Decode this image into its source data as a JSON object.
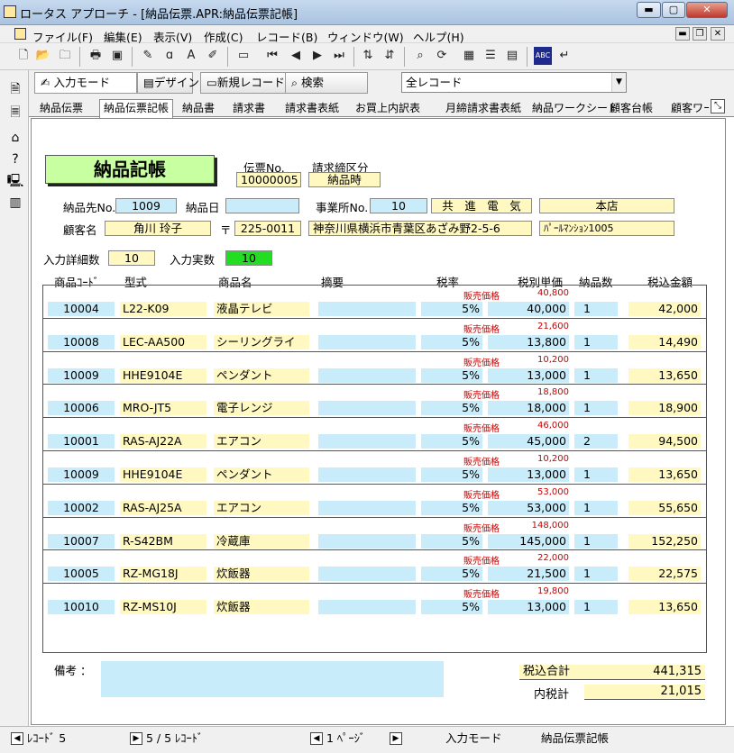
{
  "window": {
    "title": "ロータス アプローチ - [納品伝票.APR:納品伝票記帳]",
    "min_label": "▬",
    "max_label": "▢",
    "close_label": "✕"
  },
  "menu": [
    "ファイル(F)",
    "編集(E)",
    "表示(V)",
    "作成(C)",
    "レコード(B)",
    "ウィンドウ(W)",
    "ヘルプ(H)"
  ],
  "mode": {
    "input_label": "入力モード",
    "design_label": "デザイン",
    "new_record_label": "新規レコード",
    "search_label": "検索",
    "view_select": "全レコード"
  },
  "tabs": [
    "納品伝票",
    "納品伝票記帳",
    "納品書",
    "請求書",
    "請求書表紙",
    "お買上内訳表",
    "月締請求書表紙",
    "納品ワークシート",
    "顧客台帳",
    "顧客ワーク"
  ],
  "form": {
    "banner": "納品記帳",
    "slip_no_label": "伝票No.",
    "slip_no": "10000005",
    "billing_label": "請求締区分",
    "billing_value": "納品時",
    "delivery_to_label": "納品先No.",
    "delivery_to": "1009",
    "delivery_date_label": "納品日",
    "delivery_date": "",
    "office_no_label": "事業所No.",
    "office_no": "10",
    "company_name": "共　進　電　気",
    "branch_name": "本店",
    "customer_label": "顧客名",
    "customer_name": "角川 玲子",
    "postal_mark": "〒",
    "postal_code": "225-0011",
    "address": "神奈川県横浜市青葉区あざみ野2-5-6",
    "building": "ﾊﾟｰﾙﾏﾝｼｮﾝ1005",
    "detail_count_label": "入力詳細数",
    "detail_count": "10",
    "actual_count_label": "入力実数",
    "actual_count": "10",
    "sale_price_label": "販売価格",
    "headers": {
      "code": "商品ｺｰﾄﾞ",
      "model": "型式",
      "product": "商品名",
      "summary": "摘要",
      "tax_rate": "税率",
      "unit_price": "税別単価",
      "qty": "納品数",
      "amount": "税込金額"
    },
    "items": [
      {
        "code": "10004",
        "model": "L22-K09",
        "product": "液晶テレビ",
        "summary": "",
        "tax": "5%",
        "sale": "40,800",
        "price": "40,000",
        "qty": "1",
        "amount": "42,000"
      },
      {
        "code": "10008",
        "model": "LEC-AA500",
        "product": "シーリングライ",
        "summary": "",
        "tax": "5%",
        "sale": "21,600",
        "price": "13,800",
        "qty": "1",
        "amount": "14,490"
      },
      {
        "code": "10009",
        "model": "HHE9104E",
        "product": "ペンダント",
        "summary": "",
        "tax": "5%",
        "sale": "10,200",
        "price": "13,000",
        "qty": "1",
        "amount": "13,650"
      },
      {
        "code": "10006",
        "model": "MRO-JT5",
        "product": "電子レンジ",
        "summary": "",
        "tax": "5%",
        "sale": "18,800",
        "price": "18,000",
        "qty": "1",
        "amount": "18,900"
      },
      {
        "code": "10001",
        "model": "RAS-AJ22A",
        "product": "エアコン",
        "summary": "",
        "tax": "5%",
        "sale": "46,000",
        "price": "45,000",
        "qty": "2",
        "amount": "94,500"
      },
      {
        "code": "10009",
        "model": "HHE9104E",
        "product": "ペンダント",
        "summary": "",
        "tax": "5%",
        "sale": "10,200",
        "price": "13,000",
        "qty": "1",
        "amount": "13,650"
      },
      {
        "code": "10002",
        "model": "RAS-AJ25A",
        "product": "エアコン",
        "summary": "",
        "tax": "5%",
        "sale": "53,000",
        "price": "53,000",
        "qty": "1",
        "amount": "55,650"
      },
      {
        "code": "10007",
        "model": "R-S42BM",
        "product": "冷蔵庫",
        "summary": "",
        "tax": "5%",
        "sale": "148,000",
        "price": "145,000",
        "qty": "1",
        "amount": "152,250"
      },
      {
        "code": "10005",
        "model": "RZ-MG18J",
        "product": "炊飯器",
        "summary": "",
        "tax": "5%",
        "sale": "22,000",
        "price": "21,500",
        "qty": "1",
        "amount": "22,575"
      },
      {
        "code": "10010",
        "model": "RZ-MS10J",
        "product": "炊飯器",
        "summary": "",
        "tax": "5%",
        "sale": "19,800",
        "price": "13,000",
        "qty": "1",
        "amount": "13,650"
      }
    ],
    "notes_label": "備考 ：",
    "notes_value": "",
    "total_label": "税込合計",
    "total_value": "441,315",
    "tax_label": "内税計",
    "tax_value": "21,015"
  },
  "status": {
    "record": "ﾚｺｰﾄﾞ 5",
    "record_count": "5 / 5 ﾚｺｰﾄﾞ",
    "page": "1 ﾍﾟｰｼﾞ",
    "mode": "入力モード",
    "form_name": "納品伝票記帳"
  },
  "colors": {
    "field_yellow": "#fff8c0",
    "field_blue": "#c8ecfa",
    "banner_green": "#c8ffa0",
    "actual_green": "#22dd22",
    "sale_red": "#cc0000"
  }
}
